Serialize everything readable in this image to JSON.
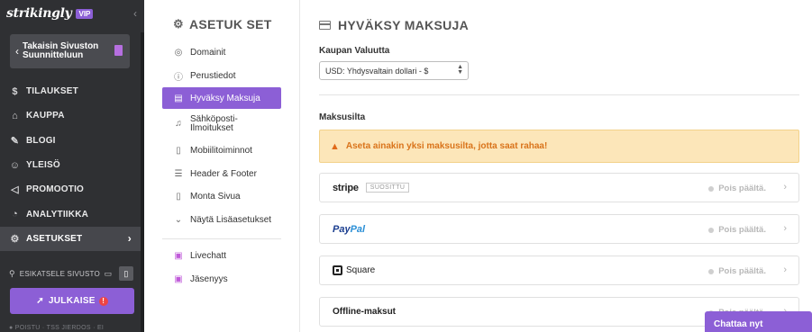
{
  "brand": {
    "logo": "strikingly",
    "badge": "VIP"
  },
  "sidebar": {
    "back_label": "Takaisin Sivuston Suunnitteluun",
    "items": [
      {
        "label": "TILAUKSET",
        "icon": "dollar-circle-icon"
      },
      {
        "label": "KAUPPA",
        "icon": "store-icon"
      },
      {
        "label": "BLOGI",
        "icon": "pen-icon"
      },
      {
        "label": "YLEISÖ",
        "icon": "people-icon"
      },
      {
        "label": "PROMOOTIO",
        "icon": "megaphone-icon"
      },
      {
        "label": "ANALYTIIKKA",
        "icon": "chart-icon"
      },
      {
        "label": "ASETUKSET",
        "icon": "gear-icon",
        "active": true
      }
    ],
    "preview_label": "ESIKATSELE SIVUSTO",
    "publish_label": "JULKAISE",
    "footer": "● POISTU · TSS JIERDOS · EI"
  },
  "settings_nav": {
    "title": "ASETUK SET",
    "items": [
      {
        "label": "Domainit",
        "icon": "globe-icon"
      },
      {
        "label": "Perustiedot",
        "icon": "info-icon"
      },
      {
        "label": "Hyväksy Maksuja",
        "icon": "card-icon",
        "active": true
      },
      {
        "label": "Sähköposti-Ilmoitukset",
        "icon": "bell-icon"
      },
      {
        "label": "Mobiilitoiminnot",
        "icon": "mobile-icon"
      },
      {
        "label": "Header & Footer",
        "icon": "layout-icon"
      },
      {
        "label": "Monta Sivua",
        "icon": "pages-icon"
      },
      {
        "label": "Näytä Lisäasetukset",
        "icon": "chevron-down-icon"
      }
    ],
    "extra_items": [
      {
        "label": "Livechatt",
        "icon": "chat-icon"
      },
      {
        "label": "Jäsenyys",
        "icon": "member-icon"
      }
    ]
  },
  "main": {
    "title": "HYVÄKSY MAKSUJA",
    "currency_label": "Kaupan Valuutta",
    "currency_value": "USD: Yhdysvaltain dollari - $",
    "gateways_label": "Maksusilta",
    "alert": "Aseta ainakin yksi maksusilta, jotta saat rahaa!",
    "gateways": [
      {
        "name": "stripe",
        "badge": "SUOSITTU",
        "status": "Pois päältä."
      },
      {
        "name_part1": "Pay",
        "name_part2": "Pal",
        "status": "Pois päältä."
      },
      {
        "name": "Square",
        "status": "Pois päältä."
      },
      {
        "name": "Offline-maksut",
        "status": "Pois päältä."
      }
    ]
  },
  "chat": {
    "label": "Chattaa nyt"
  },
  "colors": {
    "accent": "#8c5fd6",
    "sidebar_bg": "#2f3033",
    "alert_bg": "#fce6b9",
    "alert_text": "#d9731a"
  }
}
